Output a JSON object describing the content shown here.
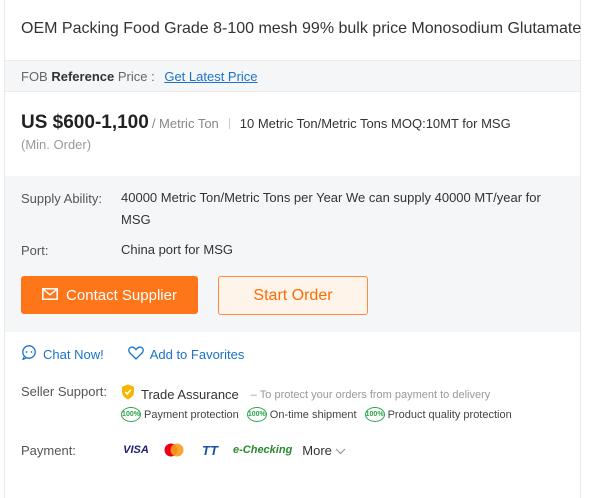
{
  "product": {
    "title": "OEM Packing Food Grade 8-100 mesh 99% bulk price Monosodium Glutamate"
  },
  "fob": {
    "prefix": "FOB",
    "reference": "Reference",
    "price_word": "Price :",
    "link": "Get Latest Price"
  },
  "pricing": {
    "price": "US $600-1,100",
    "unit": "/ Metric Ton",
    "moq": "10 Metric Ton/Metric Tons MOQ:10MT for MSG",
    "min_order": "(Min. Order)"
  },
  "details": {
    "supply_label": "Supply Ability:",
    "supply_value": "40000 Metric Ton/Metric Tons per Year We can supply 40000 MT/year for MSG",
    "port_label": "Port:",
    "port_value": "China port for MSG"
  },
  "buttons": {
    "contact": "Contact Supplier",
    "order": "Start Order"
  },
  "actions": {
    "chat": "Chat Now!",
    "favorites": "Add to Favorites"
  },
  "seller_support": {
    "label": "Seller Support:",
    "trade_assurance": "Trade Assurance",
    "trade_desc": "– To protect your orders from payment to delivery",
    "badge": "100%",
    "protections": [
      "Payment protection",
      "On-time shipment",
      "Product quality protection"
    ]
  },
  "payment": {
    "label": "Payment:",
    "methods": [
      "VISA",
      "TT",
      "e-Checking"
    ],
    "more": "More"
  },
  "colors": {
    "accent_orange": "#ff7519",
    "link_blue": "#1a73c9",
    "assurance_green": "#2aa54a"
  }
}
